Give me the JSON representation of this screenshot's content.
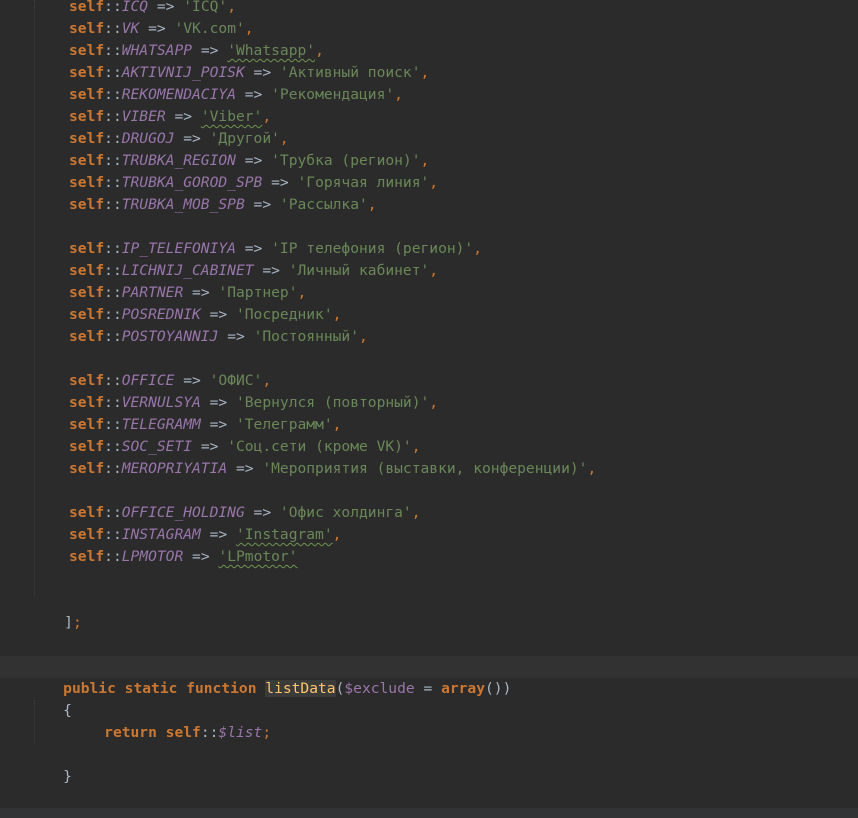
{
  "code": {
    "self_kw": "self",
    "scope_op": "::",
    "arrow": "=>",
    "entries": [
      {
        "const": "ICQ",
        "value": "'ICQ'",
        "squiggle": false
      },
      {
        "const": "VK",
        "value": "'VK.com'",
        "squiggle": false
      },
      {
        "const": "WHATSAPP",
        "value": "'Whatsapp'",
        "squiggle": true
      },
      {
        "const": "AKTIVNIJ_POISK",
        "value": "'Активный поиск'",
        "squiggle": false
      },
      {
        "const": "REKOMENDACIYA",
        "value": "'Рекомендация'",
        "squiggle": false
      },
      {
        "const": "VIBER",
        "value": "'Viber'",
        "squiggle": true
      },
      {
        "const": "DRUGOJ",
        "value": "'Другой'",
        "squiggle": false
      },
      {
        "const": "TRUBKA_REGION",
        "value": "'Трубка (регион)'",
        "squiggle": false
      },
      {
        "const": "TRUBKA_GOROD_SPB",
        "value": "'Горячая линия'",
        "squiggle": false
      },
      {
        "const": "TRUBKA_MOB_SPB",
        "value": "'Рассылка'",
        "squiggle": false
      },
      null,
      {
        "const": "IP_TELEFONIYA",
        "value": "'IP телефония (регион)'",
        "squiggle": false
      },
      {
        "const": "LICHNIJ_CABINET",
        "value": "'Личный кабинет'",
        "squiggle": false
      },
      {
        "const": "PARTNER",
        "value": "'Партнер'",
        "squiggle": false
      },
      {
        "const": "POSREDNIK",
        "value": "'Посредник'",
        "squiggle": false
      },
      {
        "const": "POSTOYANNIJ",
        "value": "'Постоянный'",
        "squiggle": false
      },
      null,
      {
        "const": "OFFICE",
        "value": "'ОФИС'",
        "squiggle": false
      },
      {
        "const": "VERNULSYA",
        "value": "'Вернулся (повторный)'",
        "squiggle": false
      },
      {
        "const": "TELEGRAMM",
        "value": "'Телеграмм'",
        "squiggle": false
      },
      {
        "const": "SOC_SETI",
        "value": "'Соц.сети (кроме VK)'",
        "squiggle": false
      },
      {
        "const": "MEROPRIYATIA",
        "value": "'Мероприятия (выставки, конференции)'",
        "squiggle": false
      },
      null,
      {
        "const": "OFFICE_HOLDING",
        "value": "'Офис холдинга'",
        "squiggle": false
      },
      {
        "const": "INSTAGRAM",
        "value": "'Instagram'",
        "squiggle": true
      },
      {
        "const": "LPMOTOR",
        "value": "'LPmotor'",
        "squiggle": true,
        "last": true
      }
    ],
    "array_close": "]",
    "array_close_semicolon": ";",
    "func_decl": {
      "public": "public",
      "static": "static",
      "function": "function",
      "name": "listData",
      "open_paren": "(",
      "param": "$exclude",
      "equals": "=",
      "array_kw": "array",
      "array_parens": "()",
      "close_paren": ")"
    },
    "open_brace": "{",
    "return_kw": "return",
    "static_var": "$list",
    "semicolon": ";",
    "close_brace": "}"
  },
  "colors": {
    "background": "#2b2b2b",
    "keyword": "#cc7832",
    "constant": "#9876aa",
    "string": "#6a8759",
    "function": "#ffc66d",
    "text": "#a9b7c6",
    "caret_line": "#323232"
  }
}
